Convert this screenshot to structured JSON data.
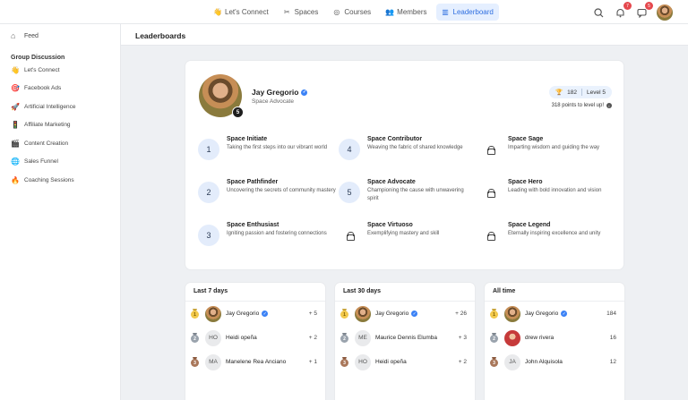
{
  "nav": {
    "items": [
      {
        "icon": "👋",
        "label": "Let's Connect"
      },
      {
        "icon": "✂",
        "label": "Spaces"
      },
      {
        "icon": "◎",
        "label": "Courses"
      },
      {
        "icon": "👥",
        "label": "Members"
      },
      {
        "icon": "▥",
        "label": "Leaderboard"
      }
    ],
    "notifications_badge": "7",
    "messages_badge": "5"
  },
  "sidebar": {
    "feed_label": "Feed",
    "group_heading": "Group Discussion",
    "items": [
      {
        "emoji": "👋",
        "label": "Let's Connect"
      },
      {
        "emoji": "🎯",
        "label": "Facebook Ads"
      },
      {
        "emoji": "🚀",
        "label": "Artificial Intelligence"
      },
      {
        "emoji": "🚦",
        "label": "Affiliate Marketing"
      },
      {
        "emoji": "🎬",
        "label": "Content Creation"
      },
      {
        "emoji": "🌐",
        "label": "Sales Funnel"
      },
      {
        "emoji": "🔥",
        "label": "Coaching Sessions"
      }
    ]
  },
  "page": {
    "title": "Leaderboards"
  },
  "profile": {
    "name": "Jay Gregorio",
    "title": "Space Advocate",
    "level_badge": "5",
    "points": "182",
    "level_label": "Level 5",
    "level_up_text": "318 points to level up!"
  },
  "levels": [
    {
      "num": "1",
      "title": "Space Initiate",
      "desc": "Taking the first steps into our vibrant world",
      "locked": false
    },
    {
      "num": "4",
      "title": "Space Contributor",
      "desc": "Weaving the fabric of shared knowledge",
      "locked": false
    },
    {
      "num": "",
      "title": "Space Sage",
      "desc": "Imparting wisdom and guiding the way",
      "locked": true
    },
    {
      "num": "2",
      "title": "Space Pathfinder",
      "desc": "Uncovering the secrets of community mastery",
      "locked": false
    },
    {
      "num": "5",
      "title": "Space Advocate",
      "desc": "Championing the cause with unwavering spirit",
      "locked": false
    },
    {
      "num": "",
      "title": "Space Hero",
      "desc": "Leading with bold innovation and vision",
      "locked": true
    },
    {
      "num": "3",
      "title": "Space Enthusiast",
      "desc": "Igniting passion and fostering connections",
      "locked": false
    },
    {
      "num": "",
      "title": "Space Virtuoso",
      "desc": "Exemplifying mastery and skill",
      "locked": true
    },
    {
      "num": "",
      "title": "Space Legend",
      "desc": "Eternally inspiring excellence and unity",
      "locked": true
    }
  ],
  "boards": [
    {
      "title": "Last 7 days",
      "rows": [
        {
          "rank": "1",
          "initials": "",
          "photo": "jay",
          "name": "Jay Gregorio",
          "verified": true,
          "points": "+ 5"
        },
        {
          "rank": "2",
          "initials": "HO",
          "photo": "",
          "name": "Heidi opeña",
          "verified": false,
          "points": "+ 2"
        },
        {
          "rank": "3",
          "initials": "MA",
          "photo": "",
          "name": "Manelene Rea Anciano",
          "verified": false,
          "points": "+ 1"
        }
      ]
    },
    {
      "title": "Last 30 days",
      "rows": [
        {
          "rank": "1",
          "initials": "",
          "photo": "jay",
          "name": "Jay Gregorio",
          "verified": true,
          "points": "+ 26"
        },
        {
          "rank": "2",
          "initials": "ME",
          "photo": "",
          "name": "Maurice Dennis Elumba",
          "verified": false,
          "points": "+ 3"
        },
        {
          "rank": "3",
          "initials": "HO",
          "photo": "",
          "name": "Heidi opeña",
          "verified": false,
          "points": "+ 2"
        }
      ]
    },
    {
      "title": "All time",
      "rows": [
        {
          "rank": "1",
          "initials": "",
          "photo": "jay",
          "name": "Jay Gregorio",
          "verified": true,
          "points": "184"
        },
        {
          "rank": "2",
          "initials": "",
          "photo": "drew",
          "name": "drew rivera",
          "verified": false,
          "points": "16"
        },
        {
          "rank": "3",
          "initials": "JA",
          "photo": "",
          "name": "John Alquisola",
          "verified": false,
          "points": "12"
        }
      ]
    }
  ]
}
